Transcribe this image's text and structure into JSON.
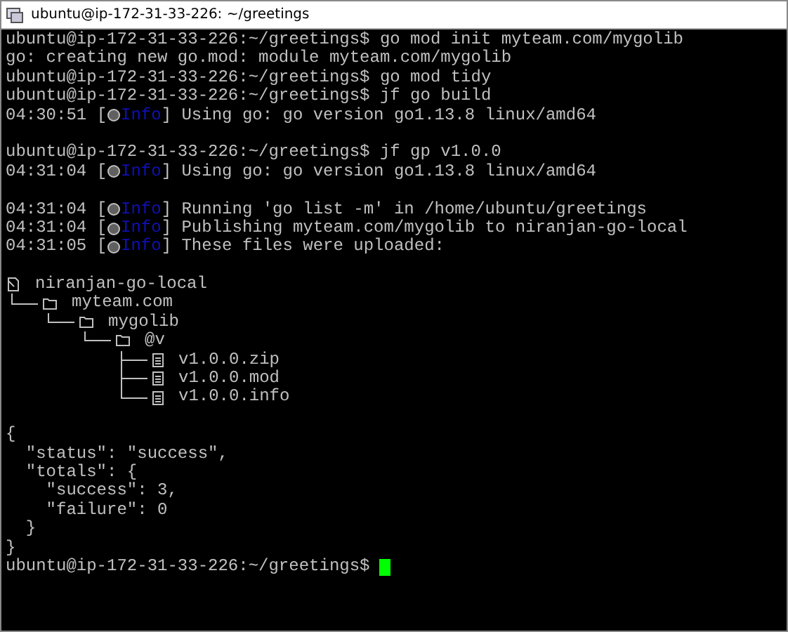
{
  "window": {
    "title": "ubuntu@ip-172-31-33-226: ~/greetings"
  },
  "lines": [
    {
      "kind": "text",
      "text": "ubuntu@ip-172-31-33-226:~/greetings$ go mod init myteam.com/mygolib"
    },
    {
      "kind": "text",
      "text": "go: creating new go.mod: module myteam.com/mygolib"
    },
    {
      "kind": "text",
      "text": "ubuntu@ip-172-31-33-226:~/greetings$ go mod tidy"
    },
    {
      "kind": "text",
      "text": "ubuntu@ip-172-31-33-226:~/greetings$ jf go build"
    },
    {
      "kind": "log",
      "time": "04:30:51",
      "brackets": [
        "[",
        "]"
      ],
      "level": "Info",
      "message": "Using go: go version go1.13.8 linux/amd64"
    },
    {
      "kind": "blank"
    },
    {
      "kind": "text",
      "text": "ubuntu@ip-172-31-33-226:~/greetings$ jf gp v1.0.0"
    },
    {
      "kind": "log",
      "time": "04:31:04",
      "brackets": [
        "[",
        "]"
      ],
      "level": "Info",
      "message": "Using go: go version go1.13.8 linux/amd64"
    },
    {
      "kind": "blank"
    },
    {
      "kind": "log",
      "time": "04:31:04",
      "brackets": [
        "[",
        "]"
      ],
      "level": "Info",
      "message": "Running 'go list -m' in /home/ubuntu/greetings"
    },
    {
      "kind": "log",
      "time": "04:31:04",
      "brackets": [
        "[",
        "]"
      ],
      "level": "Info",
      "message": "Publishing myteam.com/mygolib to niranjan-go-local"
    },
    {
      "kind": "log",
      "time": "04:31:05",
      "brackets": [
        "[",
        "]"
      ],
      "level": "Info",
      "message": "These files were uploaded:"
    },
    {
      "kind": "blank"
    },
    {
      "kind": "tree",
      "root": {
        "kind": "repo",
        "label": "niranjan-go-local",
        "children": [
          {
            "kind": "folder",
            "label": "myteam.com",
            "children": [
              {
                "kind": "folder",
                "label": "mygolib",
                "children": [
                  {
                    "kind": "folder",
                    "label": "@v",
                    "children": [
                      {
                        "kind": "file",
                        "label": "v1.0.0.zip"
                      },
                      {
                        "kind": "file",
                        "label": "v1.0.0.mod"
                      },
                      {
                        "kind": "file",
                        "label": "v1.0.0.info"
                      }
                    ]
                  }
                ]
              }
            ]
          }
        ]
      }
    },
    {
      "kind": "blank"
    },
    {
      "kind": "text",
      "text": "{"
    },
    {
      "kind": "text",
      "text": "  \"status\": \"success\","
    },
    {
      "kind": "text",
      "text": "  \"totals\": {"
    },
    {
      "kind": "text",
      "text": "    \"success\": 3,"
    },
    {
      "kind": "text",
      "text": "    \"failure\": 0"
    },
    {
      "kind": "text",
      "text": "  }"
    },
    {
      "kind": "text",
      "text": "}"
    },
    {
      "kind": "prompt",
      "text": "ubuntu@ip-172-31-33-226:~/greetings$"
    }
  ]
}
